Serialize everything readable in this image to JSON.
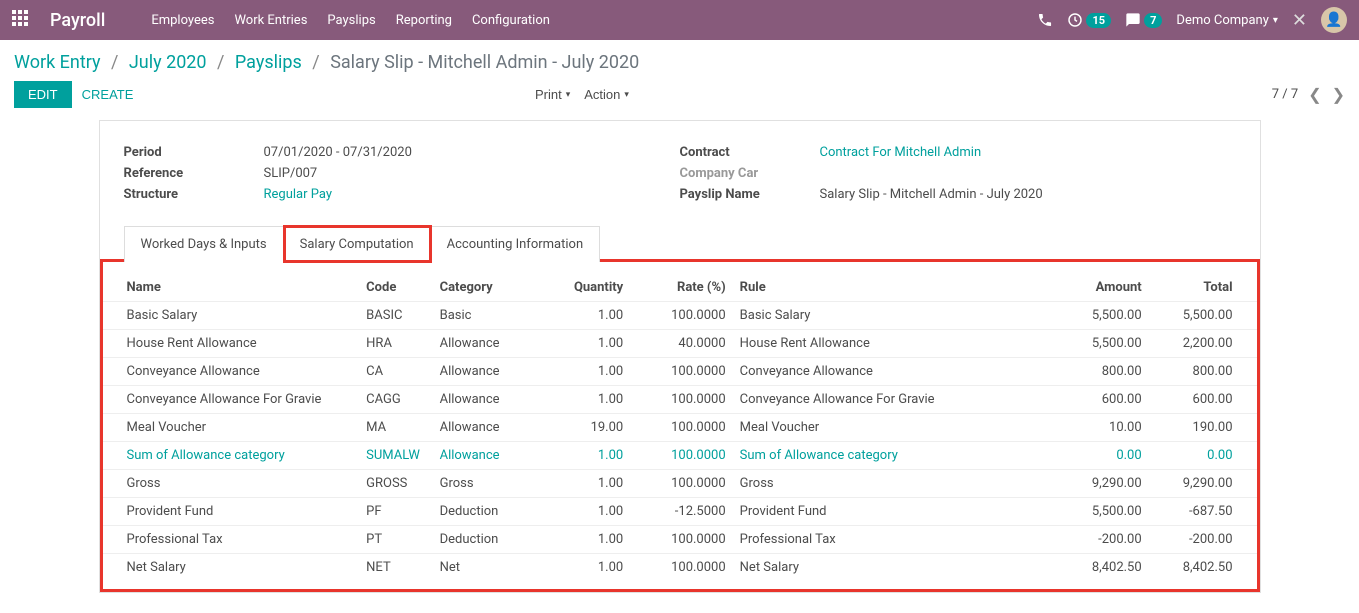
{
  "nav": {
    "brand": "Payroll",
    "menu": [
      "Employees",
      "Work Entries",
      "Payslips",
      "Reporting",
      "Configuration"
    ],
    "badge_activities": "15",
    "badge_messages": "7",
    "company": "Demo Company"
  },
  "breadcrumb": {
    "items": [
      "Work Entry",
      "July 2020",
      "Payslips"
    ],
    "current": "Salary Slip - Mitchell Admin - July 2020"
  },
  "actions": {
    "edit": "EDIT",
    "create": "CREATE",
    "print": "Print",
    "action": "Action",
    "pager": "7 / 7"
  },
  "info": {
    "left": {
      "period_label": "Period",
      "period_val": "07/01/2020 - 07/31/2020",
      "reference_label": "Reference",
      "reference_val": "SLIP/007",
      "structure_label": "Structure",
      "structure_val": "Regular Pay"
    },
    "right": {
      "contract_label": "Contract",
      "contract_val": "Contract For Mitchell Admin",
      "company_car_label": "Company Car",
      "payslip_name_label": "Payslip Name",
      "payslip_name_val": "Salary Slip - Mitchell Admin - July 2020"
    }
  },
  "tabs": {
    "t1": "Worked Days & Inputs",
    "t2": "Salary Computation",
    "t3": "Accounting Information"
  },
  "table": {
    "headers": {
      "name": "Name",
      "code": "Code",
      "category": "Category",
      "quantity": "Quantity",
      "rate": "Rate (%)",
      "rule": "Rule",
      "amount": "Amount",
      "total": "Total"
    },
    "rows": [
      {
        "name": "Basic Salary",
        "code": "BASIC",
        "category": "Basic",
        "quantity": "1.00",
        "rate": "100.0000",
        "rule": "Basic Salary",
        "amount": "5,500.00",
        "total": "5,500.00",
        "link": false
      },
      {
        "name": "House Rent Allowance",
        "code": "HRA",
        "category": "Allowance",
        "quantity": "1.00",
        "rate": "40.0000",
        "rule": "House Rent Allowance",
        "amount": "5,500.00",
        "total": "2,200.00",
        "link": false
      },
      {
        "name": "Conveyance Allowance",
        "code": "CA",
        "category": "Allowance",
        "quantity": "1.00",
        "rate": "100.0000",
        "rule": "Conveyance Allowance",
        "amount": "800.00",
        "total": "800.00",
        "link": false
      },
      {
        "name": "Conveyance Allowance For Gravie",
        "code": "CAGG",
        "category": "Allowance",
        "quantity": "1.00",
        "rate": "100.0000",
        "rule": "Conveyance Allowance For Gravie",
        "amount": "600.00",
        "total": "600.00",
        "link": false
      },
      {
        "name": "Meal Voucher",
        "code": "MA",
        "category": "Allowance",
        "quantity": "19.00",
        "rate": "100.0000",
        "rule": "Meal Voucher",
        "amount": "10.00",
        "total": "190.00",
        "link": false
      },
      {
        "name": "Sum of Allowance category",
        "code": "SUMALW",
        "category": "Allowance",
        "quantity": "1.00",
        "rate": "100.0000",
        "rule": "Sum of Allowance category",
        "amount": "0.00",
        "total": "0.00",
        "link": true
      },
      {
        "name": "Gross",
        "code": "GROSS",
        "category": "Gross",
        "quantity": "1.00",
        "rate": "100.0000",
        "rule": "Gross",
        "amount": "9,290.00",
        "total": "9,290.00",
        "link": false
      },
      {
        "name": "Provident Fund",
        "code": "PF",
        "category": "Deduction",
        "quantity": "1.00",
        "rate": "-12.5000",
        "rule": "Provident Fund",
        "amount": "5,500.00",
        "total": "-687.50",
        "link": false
      },
      {
        "name": "Professional Tax",
        "code": "PT",
        "category": "Deduction",
        "quantity": "1.00",
        "rate": "100.0000",
        "rule": "Professional Tax",
        "amount": "-200.00",
        "total": "-200.00",
        "link": false
      },
      {
        "name": "Net Salary",
        "code": "NET",
        "category": "Net",
        "quantity": "1.00",
        "rate": "100.0000",
        "rule": "Net Salary",
        "amount": "8,402.50",
        "total": "8,402.50",
        "link": false
      }
    ]
  }
}
